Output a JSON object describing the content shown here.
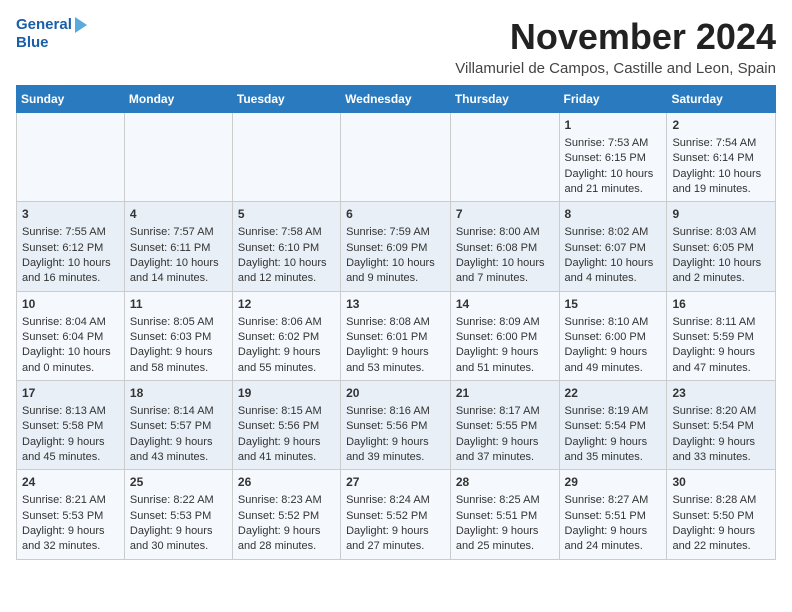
{
  "logo": {
    "line1": "General",
    "line2": "Blue"
  },
  "title": "November 2024",
  "location": "Villamuriel de Campos, Castille and Leon, Spain",
  "days_of_week": [
    "Sunday",
    "Monday",
    "Tuesday",
    "Wednesday",
    "Thursday",
    "Friday",
    "Saturday"
  ],
  "weeks": [
    {
      "days": [
        {
          "day": "",
          "info": ""
        },
        {
          "day": "",
          "info": ""
        },
        {
          "day": "",
          "info": ""
        },
        {
          "day": "",
          "info": ""
        },
        {
          "day": "",
          "info": ""
        },
        {
          "day": "1",
          "info": "Sunrise: 7:53 AM\nSunset: 6:15 PM\nDaylight: 10 hours and 21 minutes."
        },
        {
          "day": "2",
          "info": "Sunrise: 7:54 AM\nSunset: 6:14 PM\nDaylight: 10 hours and 19 minutes."
        }
      ]
    },
    {
      "days": [
        {
          "day": "3",
          "info": "Sunrise: 7:55 AM\nSunset: 6:12 PM\nDaylight: 10 hours and 16 minutes."
        },
        {
          "day": "4",
          "info": "Sunrise: 7:57 AM\nSunset: 6:11 PM\nDaylight: 10 hours and 14 minutes."
        },
        {
          "day": "5",
          "info": "Sunrise: 7:58 AM\nSunset: 6:10 PM\nDaylight: 10 hours and 12 minutes."
        },
        {
          "day": "6",
          "info": "Sunrise: 7:59 AM\nSunset: 6:09 PM\nDaylight: 10 hours and 9 minutes."
        },
        {
          "day": "7",
          "info": "Sunrise: 8:00 AM\nSunset: 6:08 PM\nDaylight: 10 hours and 7 minutes."
        },
        {
          "day": "8",
          "info": "Sunrise: 8:02 AM\nSunset: 6:07 PM\nDaylight: 10 hours and 4 minutes."
        },
        {
          "day": "9",
          "info": "Sunrise: 8:03 AM\nSunset: 6:05 PM\nDaylight: 10 hours and 2 minutes."
        }
      ]
    },
    {
      "days": [
        {
          "day": "10",
          "info": "Sunrise: 8:04 AM\nSunset: 6:04 PM\nDaylight: 10 hours and 0 minutes."
        },
        {
          "day": "11",
          "info": "Sunrise: 8:05 AM\nSunset: 6:03 PM\nDaylight: 9 hours and 58 minutes."
        },
        {
          "day": "12",
          "info": "Sunrise: 8:06 AM\nSunset: 6:02 PM\nDaylight: 9 hours and 55 minutes."
        },
        {
          "day": "13",
          "info": "Sunrise: 8:08 AM\nSunset: 6:01 PM\nDaylight: 9 hours and 53 minutes."
        },
        {
          "day": "14",
          "info": "Sunrise: 8:09 AM\nSunset: 6:00 PM\nDaylight: 9 hours and 51 minutes."
        },
        {
          "day": "15",
          "info": "Sunrise: 8:10 AM\nSunset: 6:00 PM\nDaylight: 9 hours and 49 minutes."
        },
        {
          "day": "16",
          "info": "Sunrise: 8:11 AM\nSunset: 5:59 PM\nDaylight: 9 hours and 47 minutes."
        }
      ]
    },
    {
      "days": [
        {
          "day": "17",
          "info": "Sunrise: 8:13 AM\nSunset: 5:58 PM\nDaylight: 9 hours and 45 minutes."
        },
        {
          "day": "18",
          "info": "Sunrise: 8:14 AM\nSunset: 5:57 PM\nDaylight: 9 hours and 43 minutes."
        },
        {
          "day": "19",
          "info": "Sunrise: 8:15 AM\nSunset: 5:56 PM\nDaylight: 9 hours and 41 minutes."
        },
        {
          "day": "20",
          "info": "Sunrise: 8:16 AM\nSunset: 5:56 PM\nDaylight: 9 hours and 39 minutes."
        },
        {
          "day": "21",
          "info": "Sunrise: 8:17 AM\nSunset: 5:55 PM\nDaylight: 9 hours and 37 minutes."
        },
        {
          "day": "22",
          "info": "Sunrise: 8:19 AM\nSunset: 5:54 PM\nDaylight: 9 hours and 35 minutes."
        },
        {
          "day": "23",
          "info": "Sunrise: 8:20 AM\nSunset: 5:54 PM\nDaylight: 9 hours and 33 minutes."
        }
      ]
    },
    {
      "days": [
        {
          "day": "24",
          "info": "Sunrise: 8:21 AM\nSunset: 5:53 PM\nDaylight: 9 hours and 32 minutes."
        },
        {
          "day": "25",
          "info": "Sunrise: 8:22 AM\nSunset: 5:53 PM\nDaylight: 9 hours and 30 minutes."
        },
        {
          "day": "26",
          "info": "Sunrise: 8:23 AM\nSunset: 5:52 PM\nDaylight: 9 hours and 28 minutes."
        },
        {
          "day": "27",
          "info": "Sunrise: 8:24 AM\nSunset: 5:52 PM\nDaylight: 9 hours and 27 minutes."
        },
        {
          "day": "28",
          "info": "Sunrise: 8:25 AM\nSunset: 5:51 PM\nDaylight: 9 hours and 25 minutes."
        },
        {
          "day": "29",
          "info": "Sunrise: 8:27 AM\nSunset: 5:51 PM\nDaylight: 9 hours and 24 minutes."
        },
        {
          "day": "30",
          "info": "Sunrise: 8:28 AM\nSunset: 5:50 PM\nDaylight: 9 hours and 22 minutes."
        }
      ]
    }
  ]
}
